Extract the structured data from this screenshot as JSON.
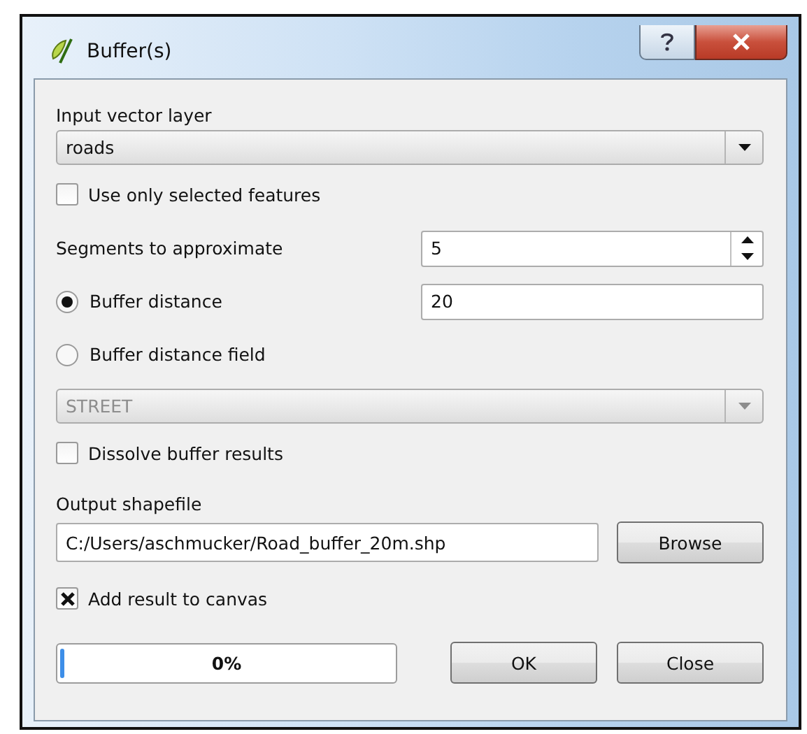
{
  "window": {
    "title": "Buffer(s)"
  },
  "input_layer": {
    "label": "Input vector layer",
    "value": "roads"
  },
  "use_selected": {
    "label": "Use only selected features",
    "checked": false
  },
  "segments": {
    "label": "Segments to approximate",
    "value": "5"
  },
  "distance_mode": [
    {
      "label": "Buffer distance",
      "selected": true
    },
    {
      "label": "Buffer distance field",
      "selected": false
    }
  ],
  "distance_value": "20",
  "field_combo": {
    "value": "STREET",
    "disabled": true
  },
  "dissolve": {
    "label": "Dissolve buffer results",
    "checked": false
  },
  "output": {
    "label": "Output shapefile",
    "value": "C:/Users/aschmucker/Road_buffer_20m.shp",
    "browse": "Browse"
  },
  "add_to_canvas": {
    "label": "Add result to canvas",
    "checked": true
  },
  "progress": {
    "level": 0,
    "reading": "0%"
  },
  "buttons": [
    "OK",
    "Close"
  ]
}
